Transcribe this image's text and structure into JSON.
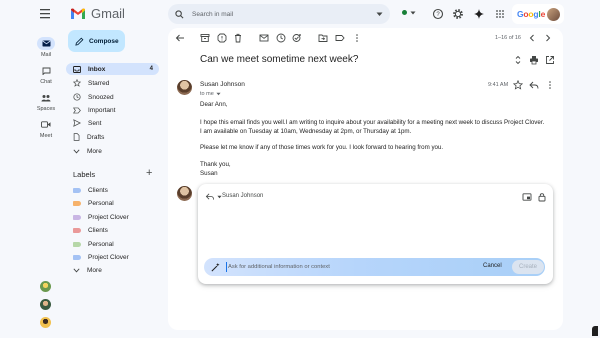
{
  "app": {
    "name": "Gmail"
  },
  "search": {
    "placeholder": "Search in mail"
  },
  "account": {
    "brand": "Google"
  },
  "colors": {
    "accent": "#0b57d0",
    "compose_bg": "#c2e7ff",
    "selected_nav": "#d3e3fd",
    "status_online": "#188038"
  },
  "rail": {
    "items": [
      {
        "label": "Mail",
        "icon": "mail-icon",
        "active": true
      },
      {
        "label": "Chat",
        "icon": "chat-icon",
        "active": false
      },
      {
        "label": "Spaces",
        "icon": "spaces-icon",
        "active": false
      },
      {
        "label": "Meet",
        "icon": "meet-icon",
        "active": false
      }
    ]
  },
  "compose": {
    "label": "Compose"
  },
  "nav": {
    "items": [
      {
        "label": "Inbox",
        "count": "4",
        "icon": "inbox-icon"
      },
      {
        "label": "Starred",
        "icon": "star-icon"
      },
      {
        "label": "Snoozed",
        "icon": "clock-icon"
      },
      {
        "label": "Important",
        "icon": "important-icon"
      },
      {
        "label": "Sent",
        "icon": "send-icon"
      },
      {
        "label": "Drafts",
        "icon": "draft-icon"
      },
      {
        "label": "More",
        "icon": "chevron-down-icon"
      }
    ]
  },
  "labels": {
    "heading": "Labels",
    "items": [
      {
        "label": "Clients",
        "color": "#a4c2f4"
      },
      {
        "label": "Personal",
        "color": "#f6b26b"
      },
      {
        "label": "Project Clover",
        "color": "#c9b6e4"
      },
      {
        "label": "Clients",
        "color": "#ea9999"
      },
      {
        "label": "Personal",
        "color": "#b6d7a8"
      },
      {
        "label": "Project Clover",
        "color": "#a4c2f4"
      }
    ],
    "more": "More"
  },
  "toolbar": {
    "pager": "1–16 of 16"
  },
  "email": {
    "subject": "Can we meet sometime next week?",
    "sender": "Susan Johnson",
    "to": "to me",
    "time": "9:41 AM",
    "body": [
      "Dear Ann,",
      "I hope this email finds you well.I am writing to inquire about your availability for a meeting next week to discuss Project Clover.",
      "I am available on Tuesday at 10am, Wednesday at 2pm, or Thursday at 1pm.",
      "Please let me know if any of those times work for you. I look forward to hearing from you.",
      "Thank you,",
      "Susan"
    ]
  },
  "reply": {
    "recipient": "Susan Johnson",
    "prompt_placeholder": "Ask for additional information or context",
    "cancel_label": "Cancel",
    "create_label": "Create"
  }
}
